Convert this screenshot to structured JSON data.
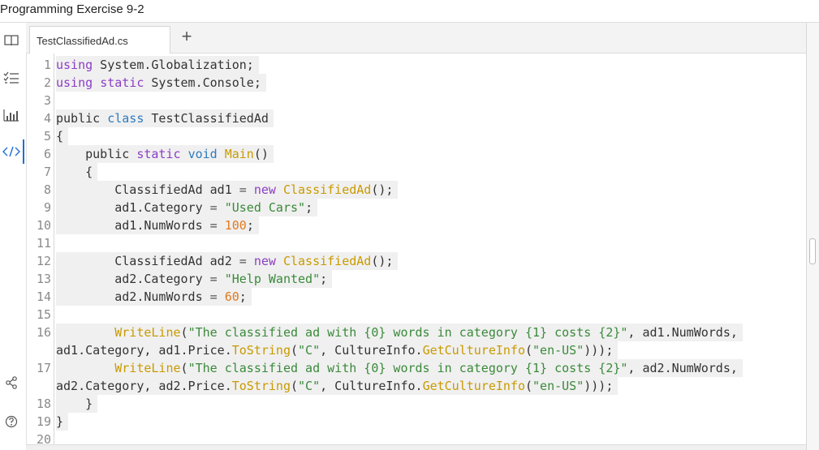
{
  "window": {
    "title": "Programming Exercise 9-2"
  },
  "sidebar": {
    "items": [
      {
        "icon": "book-icon"
      },
      {
        "icon": "checklist-icon"
      },
      {
        "icon": "bar-chart-icon"
      },
      {
        "icon": "code-icon",
        "active": true
      },
      {
        "icon": "share-icon"
      },
      {
        "icon": "help-icon"
      }
    ]
  },
  "tabs": [
    {
      "label": "TestClassifiedAd.cs",
      "active": true
    }
  ],
  "new_tab_label": "+",
  "editor": {
    "lines": [
      {
        "n": "1",
        "tokens": [
          [
            "kw",
            "using"
          ],
          [
            "t",
            " System.Globalization;"
          ]
        ]
      },
      {
        "n": "2",
        "tokens": [
          [
            "kw",
            "using"
          ],
          [
            "t",
            " "
          ],
          [
            "kw",
            "static"
          ],
          [
            "t",
            " System.Console;"
          ]
        ]
      },
      {
        "n": "3",
        "tokens": []
      },
      {
        "n": "4",
        "tokens": [
          [
            "t",
            "public "
          ],
          [
            "kb",
            "class"
          ],
          [
            "t",
            " TestClassifiedAd"
          ]
        ]
      },
      {
        "n": "5",
        "tokens": [
          [
            "t",
            "{"
          ]
        ]
      },
      {
        "n": "6",
        "tokens": [
          [
            "t",
            "    public "
          ],
          [
            "kw",
            "static"
          ],
          [
            "t",
            " "
          ],
          [
            "kb",
            "void"
          ],
          [
            "t",
            " "
          ],
          [
            "fn",
            "Main"
          ],
          [
            "t",
            "()"
          ]
        ]
      },
      {
        "n": "7",
        "tokens": [
          [
            "t",
            "    {"
          ]
        ]
      },
      {
        "n": "8",
        "tokens": [
          [
            "t",
            "        ClassifiedAd ad1 "
          ],
          [
            "pn",
            "="
          ],
          [
            "t",
            " "
          ],
          [
            "kw",
            "new"
          ],
          [
            "t",
            " "
          ],
          [
            "fn",
            "ClassifiedAd"
          ],
          [
            "t",
            "();"
          ]
        ]
      },
      {
        "n": "9",
        "tokens": [
          [
            "t",
            "        ad1.Category "
          ],
          [
            "pn",
            "="
          ],
          [
            "t",
            " "
          ],
          [
            "str",
            "\"Used Cars\""
          ],
          [
            "t",
            ";"
          ]
        ]
      },
      {
        "n": "10",
        "tokens": [
          [
            "t",
            "        ad1.NumWords "
          ],
          [
            "pn",
            "="
          ],
          [
            "t",
            " "
          ],
          [
            "num",
            "100"
          ],
          [
            "t",
            ";"
          ]
        ]
      },
      {
        "n": "11",
        "tokens": []
      },
      {
        "n": "12",
        "tokens": [
          [
            "t",
            "        ClassifiedAd ad2 "
          ],
          [
            "pn",
            "="
          ],
          [
            "t",
            " "
          ],
          [
            "kw",
            "new"
          ],
          [
            "t",
            " "
          ],
          [
            "fn",
            "ClassifiedAd"
          ],
          [
            "t",
            "();"
          ]
        ]
      },
      {
        "n": "13",
        "tokens": [
          [
            "t",
            "        ad2.Category "
          ],
          [
            "pn",
            "="
          ],
          [
            "t",
            " "
          ],
          [
            "str",
            "\"Help Wanted\""
          ],
          [
            "t",
            ";"
          ]
        ]
      },
      {
        "n": "14",
        "tokens": [
          [
            "t",
            "        ad2.NumWords "
          ],
          [
            "pn",
            "="
          ],
          [
            "t",
            " "
          ],
          [
            "num",
            "60"
          ],
          [
            "t",
            ";"
          ]
        ]
      },
      {
        "n": "15",
        "tokens": []
      },
      {
        "n": "16",
        "tokens": [
          [
            "t",
            "        "
          ],
          [
            "fn",
            "WriteLine"
          ],
          [
            "t",
            "("
          ],
          [
            "str",
            "\"The classified ad with {0} words in category {1} costs {2}\""
          ],
          [
            "t",
            ", ad1.NumWords,"
          ]
        ]
      },
      {
        "n": "",
        "tokens": [
          [
            "t",
            "ad1.Category, ad1.Price."
          ],
          [
            "fn",
            "ToString"
          ],
          [
            "t",
            "("
          ],
          [
            "str",
            "\"C\""
          ],
          [
            "t",
            ", CultureInfo."
          ],
          [
            "fn",
            "GetCultureInfo"
          ],
          [
            "t",
            "("
          ],
          [
            "str",
            "\"en-US\""
          ],
          [
            "t",
            ")));"
          ]
        ]
      },
      {
        "n": "17",
        "tokens": [
          [
            "t",
            "        "
          ],
          [
            "fn",
            "WriteLine"
          ],
          [
            "t",
            "("
          ],
          [
            "str",
            "\"The classified ad with {0} words in category {1} costs {2}\""
          ],
          [
            "t",
            ", ad2.NumWords,"
          ]
        ]
      },
      {
        "n": "",
        "tokens": [
          [
            "t",
            "ad2.Category, ad2.Price."
          ],
          [
            "fn",
            "ToString"
          ],
          [
            "t",
            "("
          ],
          [
            "str",
            "\"C\""
          ],
          [
            "t",
            ", CultureInfo."
          ],
          [
            "fn",
            "GetCultureInfo"
          ],
          [
            "t",
            "("
          ],
          [
            "str",
            "\"en-US\""
          ],
          [
            "t",
            ")));"
          ]
        ]
      },
      {
        "n": "18",
        "tokens": [
          [
            "t",
            "    }"
          ]
        ]
      },
      {
        "n": "19",
        "tokens": [
          [
            "t",
            "}"
          ]
        ]
      },
      {
        "n": "20",
        "tokens": []
      }
    ]
  },
  "colors": {
    "keyword_purple": "#8b3ec4",
    "keyword_blue": "#2e7bbf",
    "function": "#c99a00",
    "string": "#3a8a3a",
    "number": "#e07a20",
    "accent": "#1f6fd0"
  }
}
